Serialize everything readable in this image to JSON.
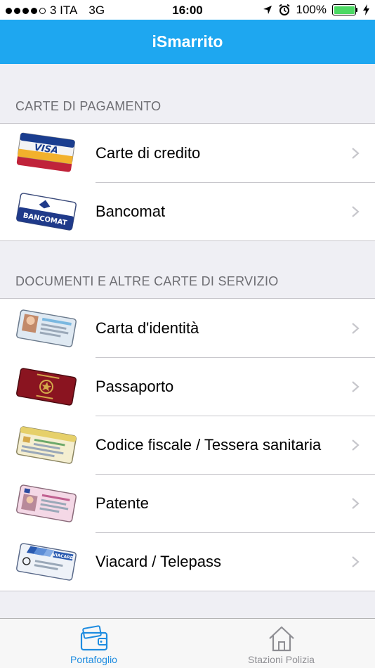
{
  "status_bar": {
    "carrier": "3 ITA",
    "network": "3G",
    "time": "16:00",
    "battery": "100%",
    "signal_bars_filled": 4,
    "signal_bars_total": 5,
    "battery_level": 1.0
  },
  "nav": {
    "title": "iSmarrito"
  },
  "sections": [
    {
      "header": "CARTE DI PAGAMENTO",
      "items": [
        {
          "label": "Carte di credito",
          "icon": "credit-card-icon"
        },
        {
          "label": "Bancomat",
          "icon": "bancomat-card-icon"
        }
      ]
    },
    {
      "header": "DOCUMENTI E ALTRE CARTE DI SERVIZIO",
      "items": [
        {
          "label": "Carta d'identità",
          "icon": "identity-card-icon"
        },
        {
          "label": "Passaporto",
          "icon": "passport-icon"
        },
        {
          "label": "Codice fiscale / Tessera sanitaria",
          "icon": "health-card-icon"
        },
        {
          "label": "Patente",
          "icon": "driving-license-icon"
        },
        {
          "label": "Viacard / Telepass",
          "icon": "viacard-icon"
        }
      ]
    }
  ],
  "card_texts": {
    "visa": "VISA",
    "bancomat": "BANCOMAT",
    "viacard": "VIACARD"
  },
  "tabs": [
    {
      "label": "Portafoglio",
      "icon": "wallet-icon",
      "active": true
    },
    {
      "label": "Stazioni Polizia",
      "icon": "home-icon",
      "active": false
    }
  ],
  "colors": {
    "nav": "#1ea7f0",
    "active_tab": "#1e8ce0",
    "inactive_tab": "#8e8e93",
    "battery": "#4cd964"
  }
}
